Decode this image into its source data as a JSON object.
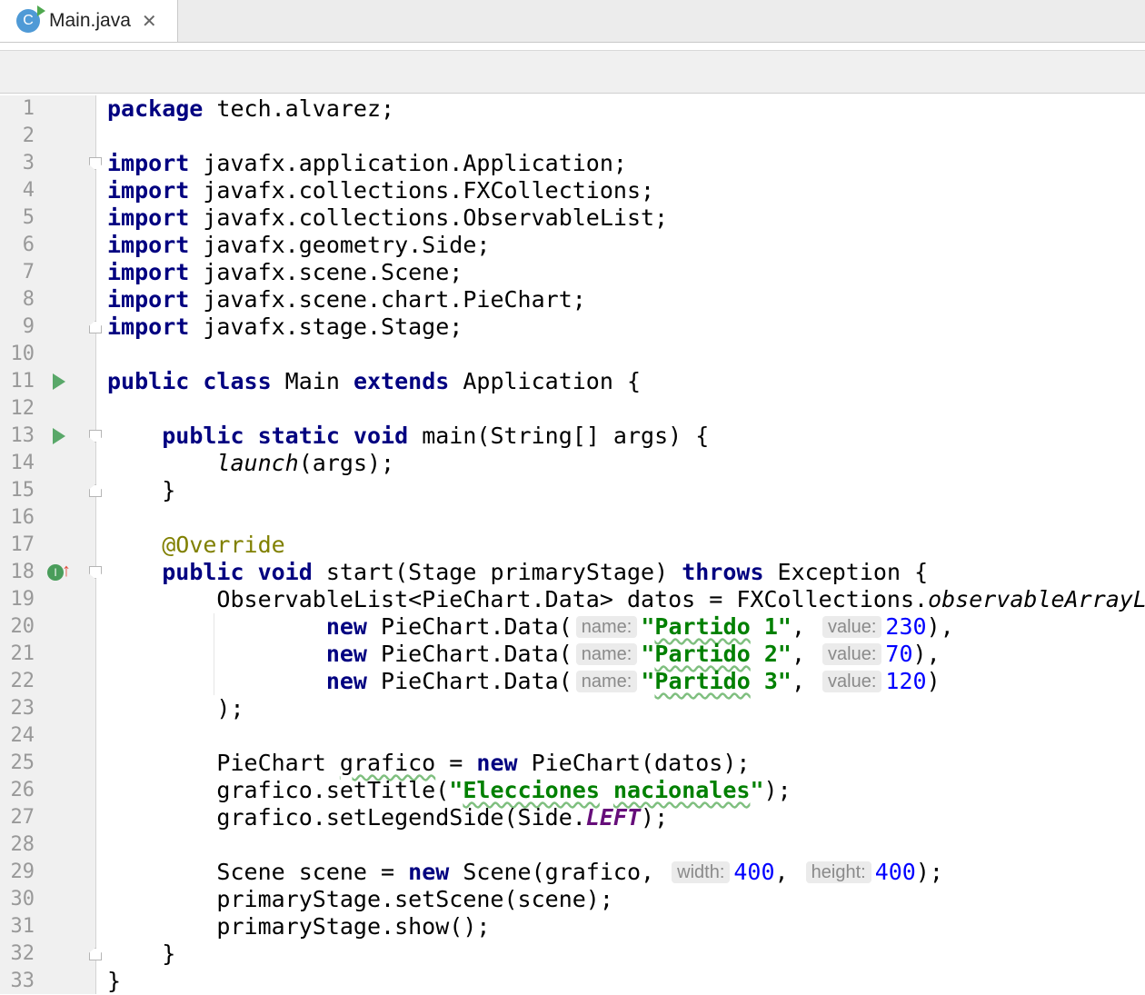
{
  "tab": {
    "icon_letter": "C",
    "title": "Main.java",
    "close_glyph": "✕"
  },
  "editor": {
    "lines": [
      {
        "n": "1",
        "c": "<span class='kw'>package</span> tech.alvarez;"
      },
      {
        "n": "2",
        "c": ""
      },
      {
        "n": "3",
        "c": "<span class='kw'>import</span> javafx.application.Application;"
      },
      {
        "n": "4",
        "c": "<span class='kw'>import</span> javafx.collections.FXCollections;"
      },
      {
        "n": "5",
        "c": "<span class='kw'>import</span> javafx.collections.ObservableList;"
      },
      {
        "n": "6",
        "c": "<span class='kw'>import</span> javafx.geometry.Side;"
      },
      {
        "n": "7",
        "c": "<span class='kw'>import</span> javafx.scene.Scene;"
      },
      {
        "n": "8",
        "c": "<span class='kw'>import</span> javafx.scene.chart.PieChart;"
      },
      {
        "n": "9",
        "c": "<span class='kw'>import</span> javafx.stage.Stage;"
      },
      {
        "n": "10",
        "c": ""
      },
      {
        "n": "11",
        "c": "<span class='kw'>public class</span> Main <span class='kw'>extends</span> Application {"
      },
      {
        "n": "12",
        "c": ""
      },
      {
        "n": "13",
        "c": "    <span class='kw'>public static void</span> main(String[] args) {"
      },
      {
        "n": "14",
        "c": "        <span class='ital'>launch</span>(args);"
      },
      {
        "n": "15",
        "c": "    }"
      },
      {
        "n": "16",
        "c": ""
      },
      {
        "n": "17",
        "c": "    <span class='ann'>@Override</span>"
      },
      {
        "n": "18",
        "c": "    <span class='kw'>public void</span> start(Stage primaryStage) <span class='kw'>throws</span> Exception {"
      },
      {
        "n": "19",
        "c": "        ObservableList&lt;PieChart.Data&gt; datos = FXCollections.<span class='ital'>observableArrayList</span>("
      },
      {
        "n": "20",
        "c": "                <span class='kw'>new</span> PieChart.Data(<span class='hint'>name:</span><span class='str'>\"<span class='wavy'>Partido</span> 1\"</span>, <span class='hint'>value:</span><span class='num'>230</span>),"
      },
      {
        "n": "21",
        "c": "                <span class='kw'>new</span> PieChart.Data(<span class='hint'>name:</span><span class='str'>\"<span class='wavy'>Partido</span> 2\"</span>, <span class='hint'>value:</span><span class='num'>70</span>),"
      },
      {
        "n": "22",
        "c": "                <span class='kw'>new</span> PieChart.Data(<span class='hint'>name:</span><span class='str'>\"<span class='wavy'>Partido</span> 3\"</span>, <span class='hint'>value:</span><span class='num'>120</span>)"
      },
      {
        "n": "23",
        "c": "        );"
      },
      {
        "n": "24",
        "c": ""
      },
      {
        "n": "25",
        "c": "        PieChart <span class='wavy'>grafico</span> = <span class='kw'>new</span> PieChart(datos);"
      },
      {
        "n": "26",
        "c": "        grafico.setTitle(<span class='str'>\"<span class='wavy'>Elecciones</span> <span class='wavy'>nacionales</span>\"</span>);"
      },
      {
        "n": "27",
        "c": "        grafico.setLegendSide(Side.<span class='const'>LEFT</span>);"
      },
      {
        "n": "28",
        "c": ""
      },
      {
        "n": "29",
        "c": "        Scene scene = <span class='kw'>new</span> Scene(grafico, <span class='hint'>width:</span><span class='num'>400</span>, <span class='hint'>height:</span><span class='num'>400</span>);"
      },
      {
        "n": "30",
        "c": "        primaryStage.setScene(scene);"
      },
      {
        "n": "31",
        "c": "        primaryStage.show();"
      },
      {
        "n": "32",
        "c": "    }"
      },
      {
        "n": "33",
        "c": "}"
      }
    ]
  }
}
